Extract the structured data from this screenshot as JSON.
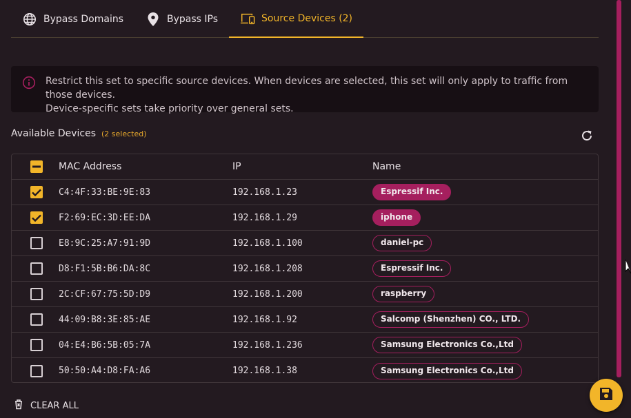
{
  "tabs": [
    {
      "label": "Bypass Domains",
      "icon": "globe-icon",
      "active": false
    },
    {
      "label": "Bypass IPs",
      "icon": "map-pin-icon",
      "active": false
    },
    {
      "label": "Source Devices (2)",
      "icon": "devices-icon",
      "active": true
    }
  ],
  "info": {
    "line1": "Restrict this set to specific source devices. When devices are selected, this set will only apply to traffic from those devices.",
    "line2": "Device-specific sets take priority over general sets."
  },
  "devices_section": {
    "title": "Available Devices",
    "selected_count": "(2 selected)"
  },
  "table": {
    "headers": {
      "mac": "MAC Address",
      "ip": "IP",
      "name": "Name"
    },
    "rows": [
      {
        "mac": "C4:4F:33:BE:9E:83",
        "ip": "192.168.1.23",
        "name": "Espressif Inc.",
        "selected": true
      },
      {
        "mac": "F2:69:EC:3D:EE:DA",
        "ip": "192.168.1.29",
        "name": "iphone",
        "selected": true
      },
      {
        "mac": "E8:9C:25:A7:91:9D",
        "ip": "192.168.1.100",
        "name": "daniel-pc",
        "selected": false
      },
      {
        "mac": "D8:F1:5B:B6:DA:8C",
        "ip": "192.168.1.208",
        "name": "Espressif Inc.",
        "selected": false
      },
      {
        "mac": "2C:CF:67:75:5D:D9",
        "ip": "192.168.1.200",
        "name": "raspberry",
        "selected": false
      },
      {
        "mac": "44:09:B8:3E:85:AE",
        "ip": "192.168.1.92",
        "name": "Salcomp (Shenzhen) CO., LTD.",
        "selected": false
      },
      {
        "mac": "04:E4:B6:5B:05:7A",
        "ip": "192.168.1.236",
        "name": "Samsung Electronics Co.,Ltd",
        "selected": false
      },
      {
        "mac": "50:50:A4:D8:FA:A6",
        "ip": "192.168.1.38",
        "name": "Samsung Electronics Co.,Ltd",
        "selected": false
      }
    ]
  },
  "actions": {
    "clear_all": "CLEAR ALL",
    "save_icon": "save-icon",
    "refresh_icon": "refresh-icon"
  },
  "colors": {
    "accent": "#f2b529",
    "chip": "#a51f5e",
    "background": "#231a20"
  }
}
